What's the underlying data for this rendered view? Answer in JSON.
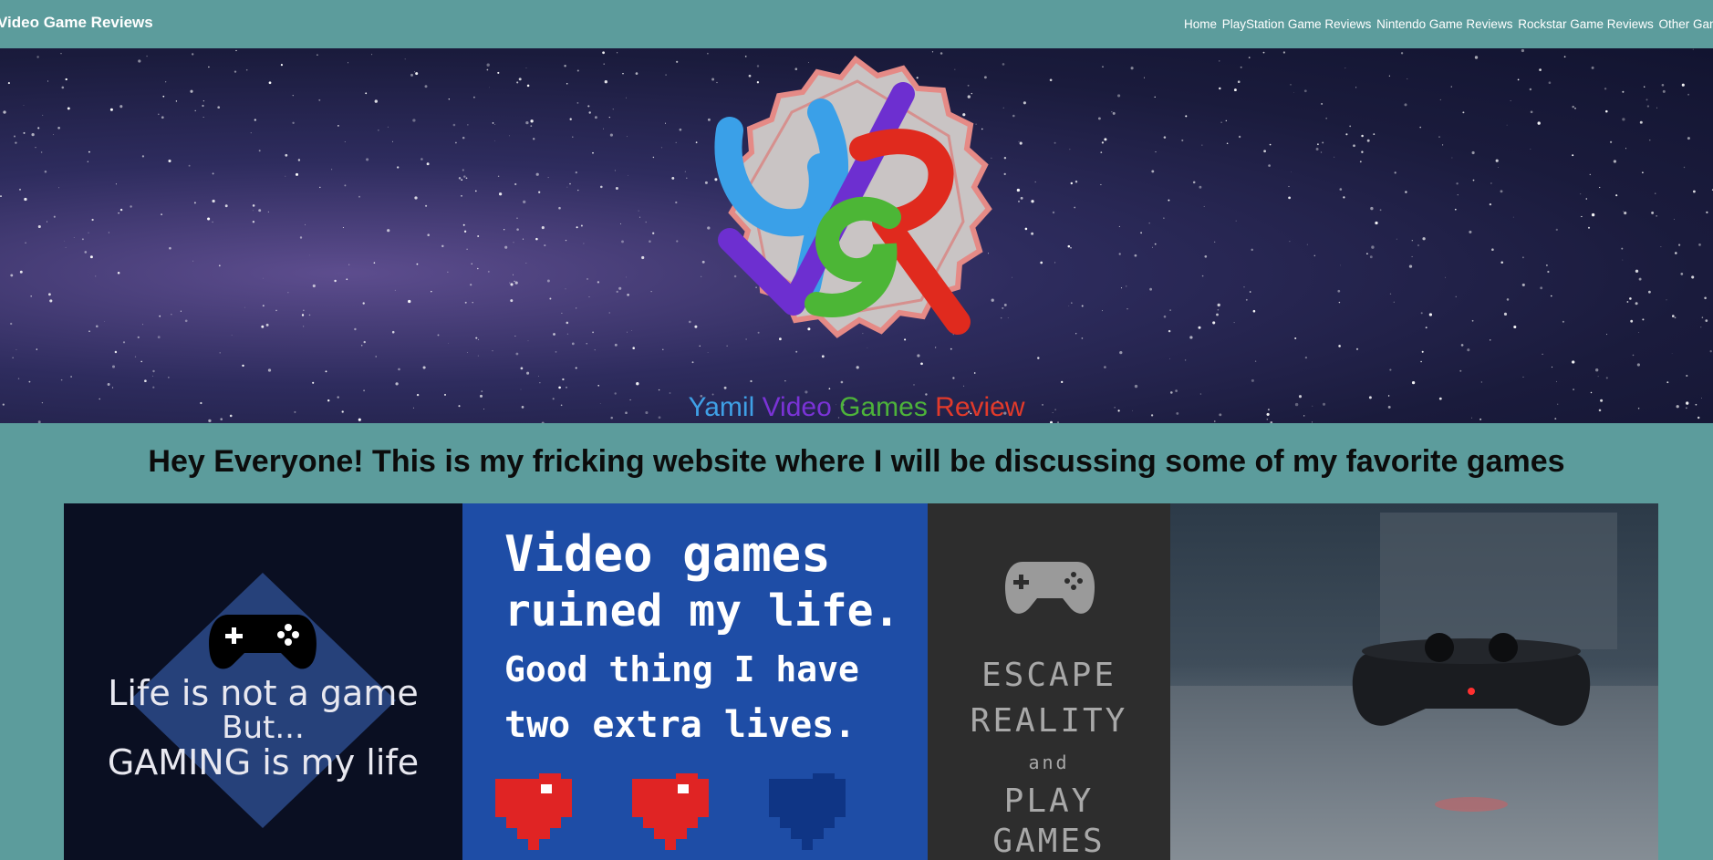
{
  "header": {
    "brand": "Video Game Reviews",
    "nav": [
      {
        "label": "Home"
      },
      {
        "label": "PlayStation Game Reviews"
      },
      {
        "label": "Nintendo Game Reviews"
      },
      {
        "label": "Rockstar Game Reviews"
      },
      {
        "label": "Other Game"
      }
    ]
  },
  "hero": {
    "logo_caption": [
      "Yamil ",
      "Video ",
      "Games ",
      "Review"
    ],
    "logo_caption_colors": [
      "#3fa0e6",
      "#7a33d6",
      "#4db33a",
      "#e23a2a"
    ]
  },
  "main": {
    "headline": "Hey Everyone! This is my fricking website where I will be discussing some of my favorite games"
  },
  "gallery": {
    "tile1": {
      "line1": "Life is not a game",
      "line2": "But...",
      "line3": "GAMING is my life"
    },
    "tile2": {
      "lines": [
        "Video games",
        "ruined my life.",
        "Good thing I have",
        "two extra lives."
      ]
    },
    "tile3": {
      "line1": "ESCAPE",
      "line2": "REALITY",
      "line3": "and",
      "line4": "PLAY",
      "line5": "GAMES"
    }
  }
}
